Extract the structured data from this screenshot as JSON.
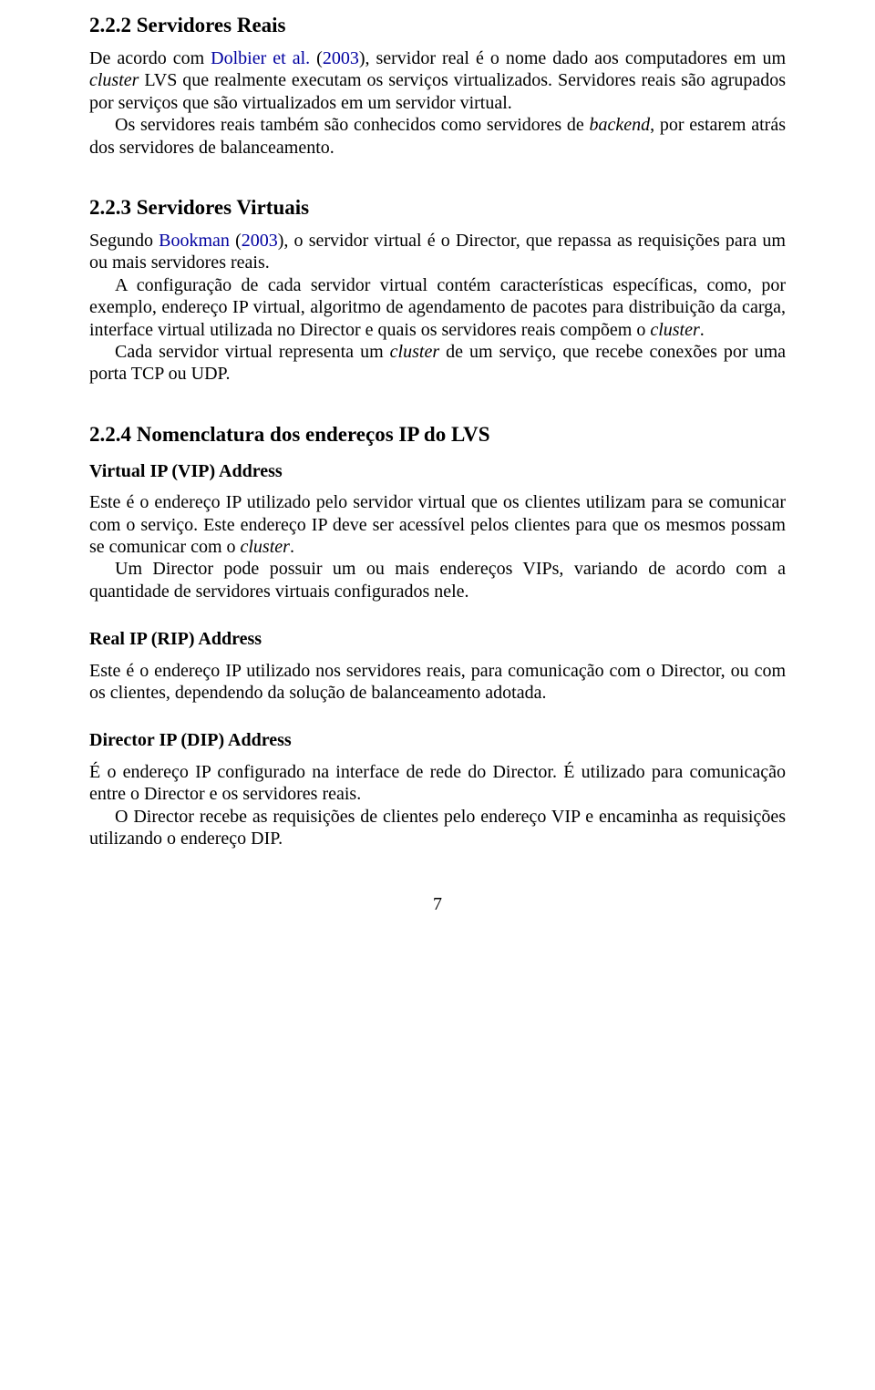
{
  "s222": {
    "heading": "2.2.2   Servidores Reais",
    "p1a": "De acordo com ",
    "cite1": "Dolbier et al.",
    "p1b": " (",
    "cite2": "2003",
    "p1c": "), servidor real é o nome dado aos computadores em um ",
    "p1_it1": "cluster",
    "p1d": " LVS que realmente executam os serviços virtualizados. Servidores reais são agrupados por serviços que são virtualizados em um servidor virtual.",
    "p2a": "Os servidores reais também são conhecidos como servidores de ",
    "p2_it1": "backend",
    "p2b": ", por estarem atrás dos servidores de balanceamento."
  },
  "s223": {
    "heading": "2.2.3   Servidores Virtuais",
    "p1a": "Segundo ",
    "cite1": "Bookman",
    "p1b": " (",
    "cite2": "2003",
    "p1c": "), o servidor virtual é o Director, que repassa as requisições para um ou mais servidores reais.",
    "p2a": "A configuração de cada servidor virtual contém características específicas, como, por exemplo, endereço IP virtual, algoritmo de agendamento de pacotes para distribuição da carga, interface virtual utilizada no Director e quais os servidores reais compõem o ",
    "p2_it1": "cluster",
    "p2b": ".",
    "p3a": "Cada servidor virtual representa um ",
    "p3_it1": "cluster",
    "p3b": " de um serviço, que recebe conexões por uma porta TCP ou UDP."
  },
  "s224": {
    "heading": "2.2.4   Nomenclatura dos endereços IP do LVS",
    "vip": {
      "heading": "Virtual IP (VIP) Address",
      "p1a": "Este é o endereço IP utilizado pelo servidor virtual que os clientes utilizam para se comunicar com o serviço. Este endereço IP deve ser acessível pelos clientes para que os mesmos possam se comunicar com o ",
      "p1_it1": "cluster",
      "p1b": ".",
      "p2": "Um Director pode possuir um ou mais endereços VIPs, variando de acordo com a quantidade de servidores virtuais configurados nele."
    },
    "rip": {
      "heading": "Real IP (RIP) Address",
      "p1": "Este é o endereço IP utilizado nos servidores reais, para comunicação com o Director, ou com os clientes, dependendo da solução de balanceamento adotada."
    },
    "dip": {
      "heading": "Director IP (DIP) Address",
      "p1": "É o endereço IP configurado na interface de rede do Director. É utilizado para comunicação entre o Director e os servidores reais.",
      "p2": "O Director recebe as requisições de clientes pelo endereço VIP e encaminha as requisições utilizando o endereço DIP."
    }
  },
  "page": "7"
}
